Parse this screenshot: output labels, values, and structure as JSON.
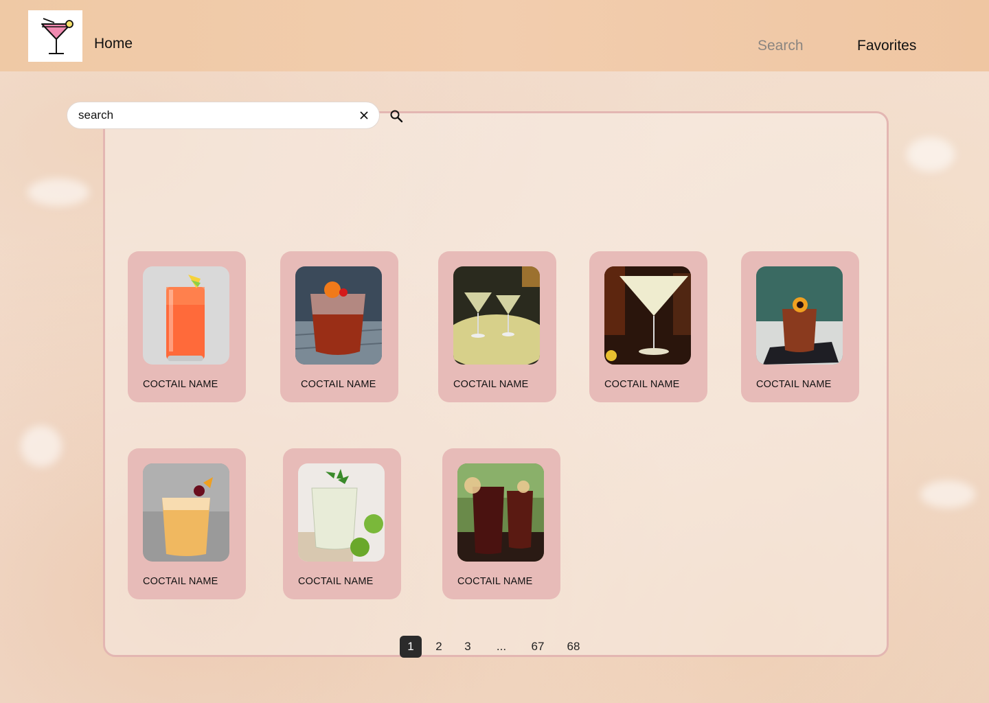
{
  "header": {
    "home_label": "Home",
    "nav": {
      "search_label": "Search",
      "favorites_label": "Favorites"
    },
    "logo_icon": "cocktail-glass-icon"
  },
  "search": {
    "value": "search",
    "clear_icon": "close-icon",
    "submit_icon": "search-icon"
  },
  "cards": [
    {
      "name": "COCTAIL NAME"
    },
    {
      "name": "COCTAIL NAME"
    },
    {
      "name": "COCTAIL NAME"
    },
    {
      "name": "COCTAIL NAME"
    },
    {
      "name": "COCTAIL NAME"
    },
    {
      "name": "COCTAIL NAME"
    },
    {
      "name": "COCTAIL NAME"
    },
    {
      "name": "COCTAIL NAME"
    }
  ],
  "pagination": {
    "pages": [
      "1",
      "2",
      "3",
      "...",
      "67",
      "68"
    ],
    "current": "1"
  },
  "colors": {
    "header": "#efc9a5",
    "card": "#e7bbb8",
    "panel_border": "#e3b6b2",
    "active_page": "#2b2b2b"
  }
}
